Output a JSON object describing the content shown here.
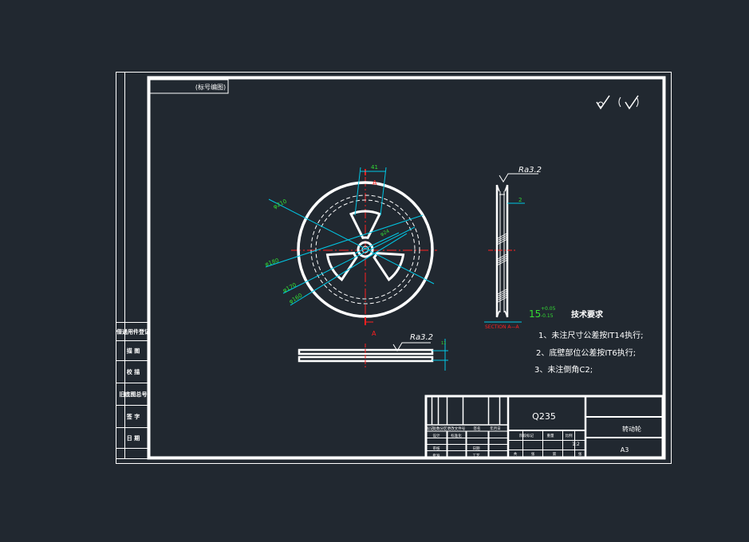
{
  "colors": {
    "background": "#212830",
    "line": "#ffffff",
    "dimension": "#00c8e6",
    "dimension_text": "#33dd33",
    "center_line": "#ff2020",
    "hatch": "#ffffff"
  },
  "drawing": {
    "code_box": "(标号编图)",
    "roughness_symbol": "√ (√)",
    "side_view_ra": "Ra3.2",
    "bottom_view_ra": "Ra3.2",
    "section_label": "SECTION A—A",
    "section_mark_top": "A",
    "section_mark_bottom": "A",
    "dim_top": "41",
    "dim_d1": "φ210",
    "dim_d2": "φ180",
    "dim_d3": "φ170",
    "dim_d4": "φ160",
    "dim_d5": "φ24",
    "side_dim": "2",
    "bottom_dim": "11",
    "tolerance_main": "15",
    "tolerance_upper": "+0.05",
    "tolerance_lower": "-0.15"
  },
  "tech_requirements": {
    "title": "技术要求",
    "items": [
      "1、未注尺寸公差按IT14执行;",
      "2、底壁部位公差按IT6执行;",
      "3、未注倒角C2;"
    ]
  },
  "left_strip": {
    "labels": [
      "借通用件登记",
      "描 图",
      "校 描",
      "旧底图总号",
      "签 字",
      "日 期"
    ]
  },
  "title_block": {
    "material": "Q235",
    "part_name": "转动轮",
    "sheet_size": "A3",
    "scale": "1:2",
    "header_cells": [
      "标记",
      "处数",
      "分区",
      "更改文件号",
      "签名",
      "年月日"
    ],
    "label_cells": [
      "设计",
      "标准化",
      "审核",
      "工艺",
      "批准",
      "日期"
    ],
    "stage_cells": [
      "阶段标记",
      "重量",
      "比例",
      "共",
      "张",
      "第",
      "张"
    ]
  }
}
